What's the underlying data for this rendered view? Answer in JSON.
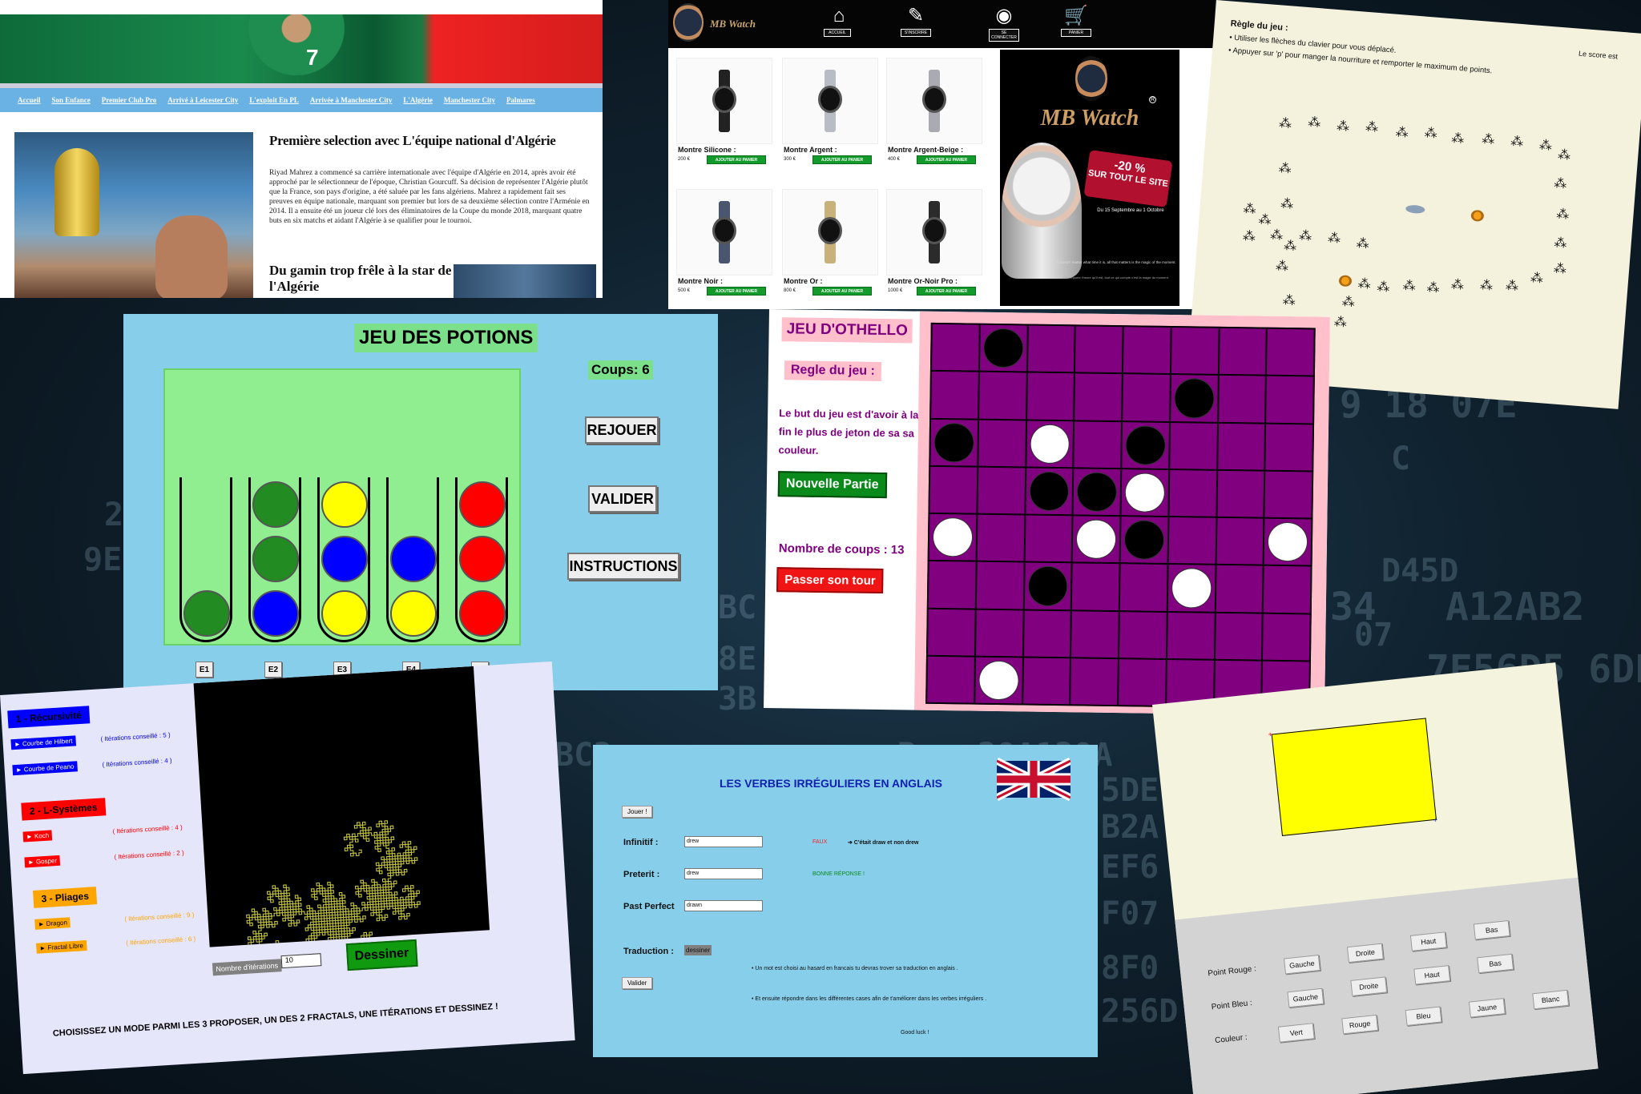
{
  "background": {
    "snippets": [
      "9 18 07E",
      "C",
      "25",
      "D45D",
      "34",
      "A12AB2",
      "07",
      "7E56D5 6DE",
      "3BC3",
      "29A129A",
      "B",
      "5DE",
      "B2A",
      "EF6",
      "F07",
      "8F0",
      "256D",
      "BC",
      "8E",
      "3B",
      "23",
      "9E"
    ]
  },
  "algeria": {
    "nav": [
      "Accueil",
      "Son Enfance",
      "Premier Club Pro",
      "Arrivé à Leicester City",
      "L'exploit En PL",
      "Arrivée à Manchester City",
      "L'Algérie",
      "Manchester City",
      "Palmares"
    ],
    "jersey_number": "7",
    "title": "Première selection avec L'équipe national d'Algérie",
    "body": "Riyad Mahrez a commencé sa carrière internationale avec l'équipe d'Algérie en 2014, après avoir été approché par le sélectionneur de l'époque, Christian Gourcuff. Sa décision de représenter l'Algérie plutôt que la France, son pays d'origine, a été saluée par les fans algériens. Mahrez a rapidement fait ses preuves en équipe nationale, marquant son premier but lors de sa deuxième sélection contre l'Arménie en 2014. Il a ensuite été un joueur clé lors des éliminatoires de la Coupe du monde 2018, marquant quatre buts en six matchs et aidant l'Algérie à se qualifier pour le tournoi.",
    "subtitle": "Du gamin trop frêle à la star de l'Algérie"
  },
  "watch": {
    "brand": "MB Watch",
    "toolbar": [
      {
        "icon": "home-icon",
        "glyph": "⌂",
        "label": "ACCUEIL"
      },
      {
        "icon": "register-icon",
        "glyph": "✎",
        "label": "S'INSCRIRE"
      },
      {
        "icon": "user-icon",
        "glyph": "◉",
        "label": "SE CONNECTER"
      },
      {
        "icon": "cart-icon",
        "glyph": "🛒",
        "label": "PANIER"
      }
    ],
    "products": [
      {
        "name": "Montre Silicone :",
        "price": "200 €",
        "button": "AJOUTER AU PANIER",
        "band": "#222222"
      },
      {
        "name": "Montre Argent :",
        "price": "300 €",
        "button": "AJOUTER AU PANIER",
        "band": "#b8bcc4"
      },
      {
        "name": "Montre Argent-Beige :",
        "price": "400 €",
        "button": "AJOUTER AU PANIER",
        "band": "#a9aab2"
      },
      {
        "name": "Montre Noir :",
        "price": "500 €",
        "button": "AJOUTER AU PANIER",
        "band": "#4a5570"
      },
      {
        "name": "Montre Or :",
        "price": "800 €",
        "button": "AJOUTER AU PANIER",
        "band": "#c8b27a"
      },
      {
        "name": "Montre Or-Noir Pro :",
        "price": "1000 €",
        "button": "AJOUTER AU PANIER",
        "band": "#2b2b2b"
      }
    ],
    "ad": {
      "brand": "MB Watch",
      "registered": "R",
      "promo_line1": "-20 %",
      "promo_line2": "SUR TOUT LE SITE",
      "date": "Du 15 Septembre au 1 Octobre",
      "quote": "It doesn't matter what time it is, all that matters is the magic of the moment.",
      "quote2": "Peu importe l'heure qu'il est, tout ce qui compte c'est la magie du moment."
    }
  },
  "snake": {
    "rules_title": "Règle du jeu :",
    "rules": [
      "• Utiliser les flèches du clavier pour vous déplacé.",
      "• Appuyer sur 'p' pour manger la nourriture et remporter le maximum de points."
    ],
    "score": "Le score est"
  },
  "potions": {
    "title": "JEU DES POTIONS",
    "moves": "Coups: 6",
    "replay": "REJOUER",
    "validate": "VALIDER",
    "instructions": "INSTRUCTIONS",
    "tubes": [
      {
        "label": "E1",
        "balls": [
          "#228b22"
        ]
      },
      {
        "label": "E2",
        "balls": [
          "#0000ff",
          "#228b22",
          "#228b22"
        ]
      },
      {
        "label": "E3",
        "balls": [
          "#ffff00",
          "#0000ff",
          "#ffff00"
        ]
      },
      {
        "label": "E4",
        "balls": [
          "#ffff00",
          "#0000ff"
        ]
      },
      {
        "label": "E5",
        "balls": [
          "#ff0000",
          "#ff0000",
          "#ff0000"
        ]
      }
    ]
  },
  "othello": {
    "title": "JEU D'OTHELLO",
    "rules_title": "Regle  du jeu :",
    "rules_text": "Le but du jeu est d'avoir à la fin le plus de jeton de sa sa couleur.",
    "new_game": "Nouvelle Partie",
    "moves": "Nombre de coups : 13",
    "pass": "Passer son tour",
    "board": [
      "_B______",
      "_____B__",
      "B_W_B___",
      "__BBW___",
      "W__WB__W",
      "__B__W__",
      "________",
      "_W______"
    ]
  },
  "fractal": {
    "sections": [
      {
        "title": "1 - Récursivité",
        "color": "#0000ff",
        "options": [
          {
            "label": "► Courbe de Hilbert",
            "hint": "( Itérations conseillé : 5 )"
          },
          {
            "label": "► Courbe de Peano",
            "hint": "( Itérations conseillé : 4 )"
          }
        ]
      },
      {
        "title": "2 - L-Systèmes",
        "color": "#ff0000",
        "options": [
          {
            "label": "► Koch",
            "hint": "( Itérations conseillé : 4 )"
          },
          {
            "label": "► Gosper",
            "hint": "( Itérations conseillé : 2 )"
          }
        ]
      },
      {
        "title": "3 - Pliages",
        "color": "#ffa500",
        "options": [
          {
            "label": "► Dragon",
            "hint": "( Itérations conseillé : 9 )"
          },
          {
            "label": "► Fractal Libre",
            "hint": "( Itérations conseillé : 6 )"
          }
        ]
      }
    ],
    "iterations_label": "Nombre d'itérations",
    "iterations_value": "10",
    "draw": "Dessiner",
    "footer": "CHOISISSEZ UN MODE PARMI LES 3 PROPOSER, UN DES 2 FRACTALS, UNE ITÉRATIONS ET DESSINEZ !"
  },
  "verbs": {
    "title": "LES VERBES IRRÉGULIERS EN ANGLAIS",
    "play": "Jouer !",
    "infinitive_label": "Infinitif :",
    "infinitive_value": "drew",
    "preterit_label": "Preterit :",
    "preterit_value": "drew",
    "past_perfect_label": "Past Perfect",
    "past_perfect_value": "drawn",
    "false_label": "FAUX",
    "false_text": "➔   C'était draw et non drew",
    "good_answer": "BONNE RÉPONSE !",
    "translation_label": "Traduction :",
    "translation_value": "dessiner",
    "validate": "Valider",
    "note1": "• Un mot est choisi au hasard en francais tu devras trover sa traduction en anglais .",
    "note2": "• Et ensuite répondre dans les différentes cases afin de t'améliorer dans les verbes irréguliers .",
    "good_luck": "Good luck !"
  },
  "rect": {
    "rows": [
      {
        "label": "Point Rouge :",
        "buttons": [
          "Gauche",
          "Droite",
          "Haut",
          "Bas"
        ]
      },
      {
        "label": "Point Bleu :",
        "buttons": [
          "Gauche",
          "Droite",
          "Haut",
          "Bas"
        ]
      },
      {
        "label": "Couleur :",
        "buttons": [
          "Vert",
          "Rouge",
          "Bleu",
          "Jaune",
          "Blanc"
        ]
      }
    ]
  }
}
